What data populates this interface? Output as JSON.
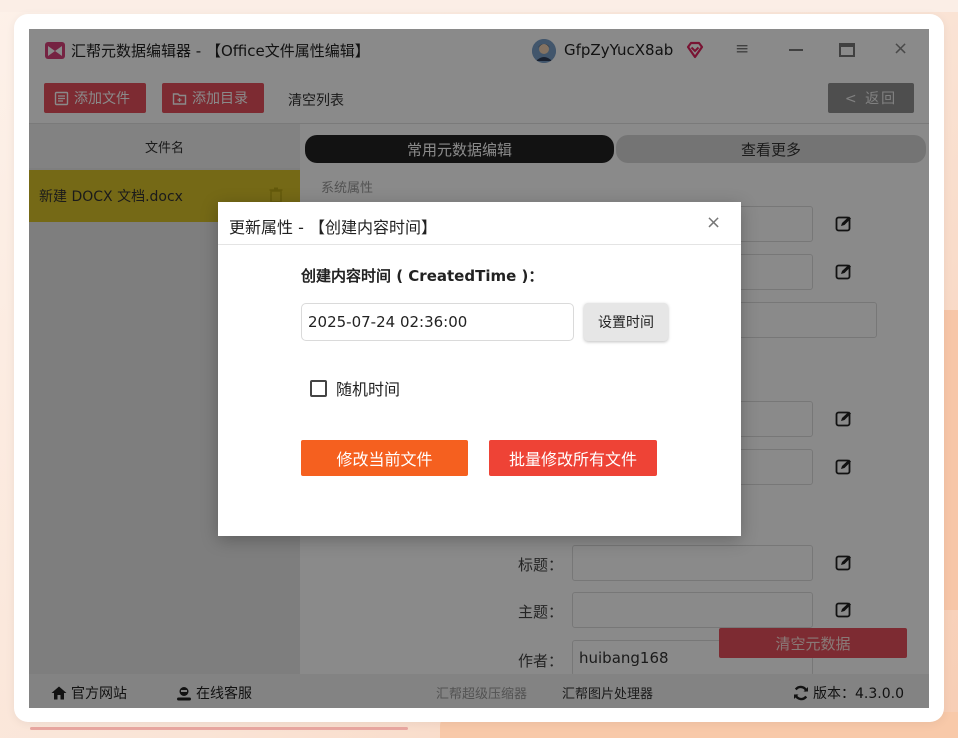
{
  "app": {
    "title": "汇帮元数据编辑器 - 【Office文件属性编辑】",
    "user_name": "GfpZyYucX8ab",
    "window_controls": {
      "menu": "≡",
      "close": "×"
    }
  },
  "toolbar": {
    "add_file": "添加文件",
    "add_dir": "添加目录",
    "clear_list": "清空列表",
    "back": "< 返回"
  },
  "file_list": {
    "header": "文件名",
    "files": [
      {
        "name": "新建 DOCX 文档.docx"
      }
    ]
  },
  "tabs": [
    {
      "label": "常用元数据编辑"
    },
    {
      "label": "查看更多"
    }
  ],
  "properties": {
    "section_label": "系统属性",
    "title_label": "标题：",
    "subject_label": "主题：",
    "author_label": "作者：",
    "author_value": "huibang168",
    "clear_metadata": "清空元数据"
  },
  "status_bar": {
    "website": "官方网站",
    "service": "在线客服",
    "compressor": "汇帮超级压缩器",
    "image_processor": "汇帮图片处理器",
    "version": "版本：4.3.0.0"
  },
  "dialog": {
    "title": "更新属性 - 【创建内容时间】",
    "close": "×",
    "field_label": "创建内容时间 ( CreatedTime )：",
    "value": "2025-07-24 02:36:00",
    "set_time": "设置时间",
    "random_time": "随机时间",
    "random_checked": false,
    "modify_current": "修改当前文件",
    "modify_all": "批量修改所有文件"
  },
  "colors": {
    "accent_red": "#e8515d",
    "modify_current_btn": "#f5601f",
    "modify_all_btn": "#ee4336",
    "selected_file_row": "#d8c22a"
  }
}
